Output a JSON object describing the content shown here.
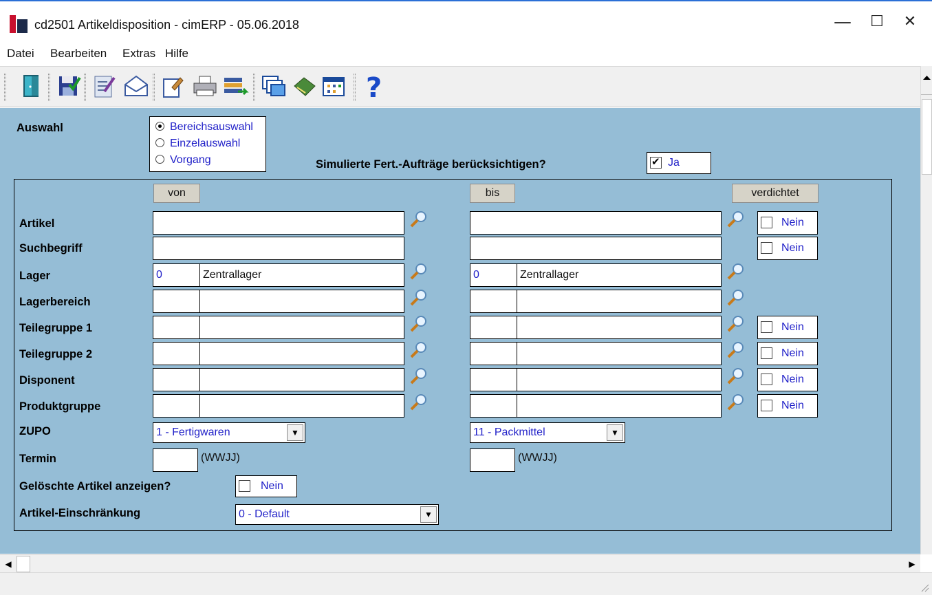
{
  "window": {
    "title": "cd2501 Artikeldisposition - cimERP - 05.06.2018",
    "minimize": "—",
    "maximize": "☐",
    "close": "✕"
  },
  "menu": [
    "Datei",
    "Bearbeiten",
    "Extras",
    "Hilfe"
  ],
  "toolbar": {
    "icons": [
      "exit-door-icon",
      "save-icon",
      "edit-checklist-icon",
      "mail-icon",
      "properties-icon",
      "print-icon",
      "transfer-icon",
      "windows-icon",
      "book-icon",
      "table-icon",
      "help-icon"
    ]
  },
  "form": {
    "auswahl_label": "Auswahl",
    "auswahl_options": [
      "Bereichsauswahl",
      "Einzelauswahl",
      "Vorgang"
    ],
    "simuliert_label": "Simulierte Fert.-Aufträge berücksichtigen?",
    "simuliert_value": "Ja",
    "col_von": "von",
    "col_bis": "bis",
    "col_verdichtet": "verdichtet",
    "rows": {
      "artikel": "Artikel",
      "suchbegriff": "Suchbegriff",
      "lager": "Lager",
      "lagerbereich": "Lagerbereich",
      "teilegruppe1": "Teilegruppe 1",
      "teilegruppe2": "Teilegruppe 2",
      "disponent": "Disponent",
      "produktgruppe": "Produktgruppe",
      "zupo": "ZUPO",
      "termin": "Termin"
    },
    "lager_von_code": "0",
    "lager_von_name": "Zentrallager",
    "lager_bis_code": "0",
    "lager_bis_name": "Zentrallager",
    "nein": "Nein",
    "zupo_von": "1 - Fertigwaren",
    "zupo_bis": "11 - Packmittel",
    "termin_hint": "(WWJJ)",
    "geloeschte_label": "Gelöschte Artikel anzeigen?",
    "einschraenkung_label": "Artikel-Einschränkung",
    "einschraenkung_value": "0 - Default"
  }
}
